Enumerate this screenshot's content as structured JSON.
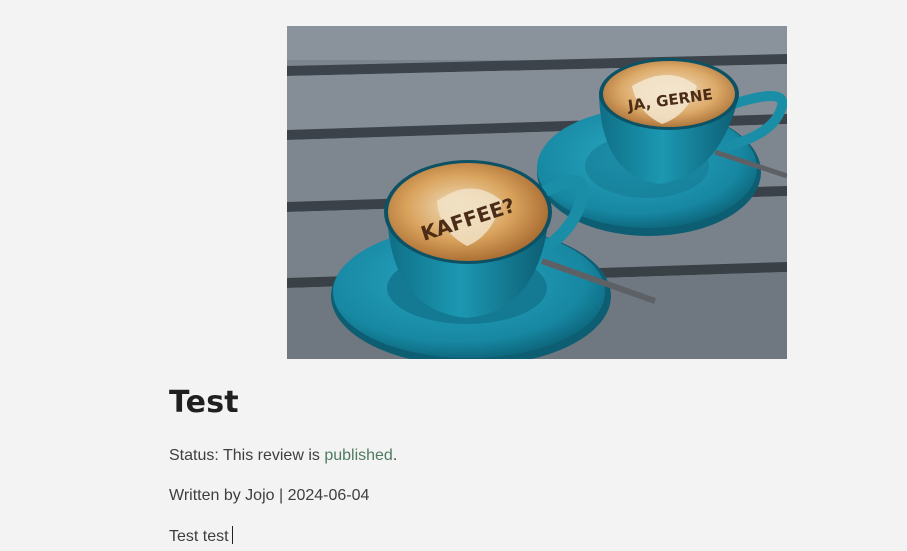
{
  "article": {
    "image": {
      "cup_front_text": "KAFFEE?",
      "cup_back_text": "JA, GERNE",
      "colors": {
        "table": "#7c858d",
        "cup": "#1a8da7",
        "foam": "#d8a15a"
      }
    },
    "title": "Test",
    "status": {
      "prefix": "Status: This review is ",
      "value": "published",
      "suffix": ".",
      "color": "#4e7b62"
    },
    "byline": "Written by Jojo | 2024-06-04",
    "body_text": "Test test"
  }
}
